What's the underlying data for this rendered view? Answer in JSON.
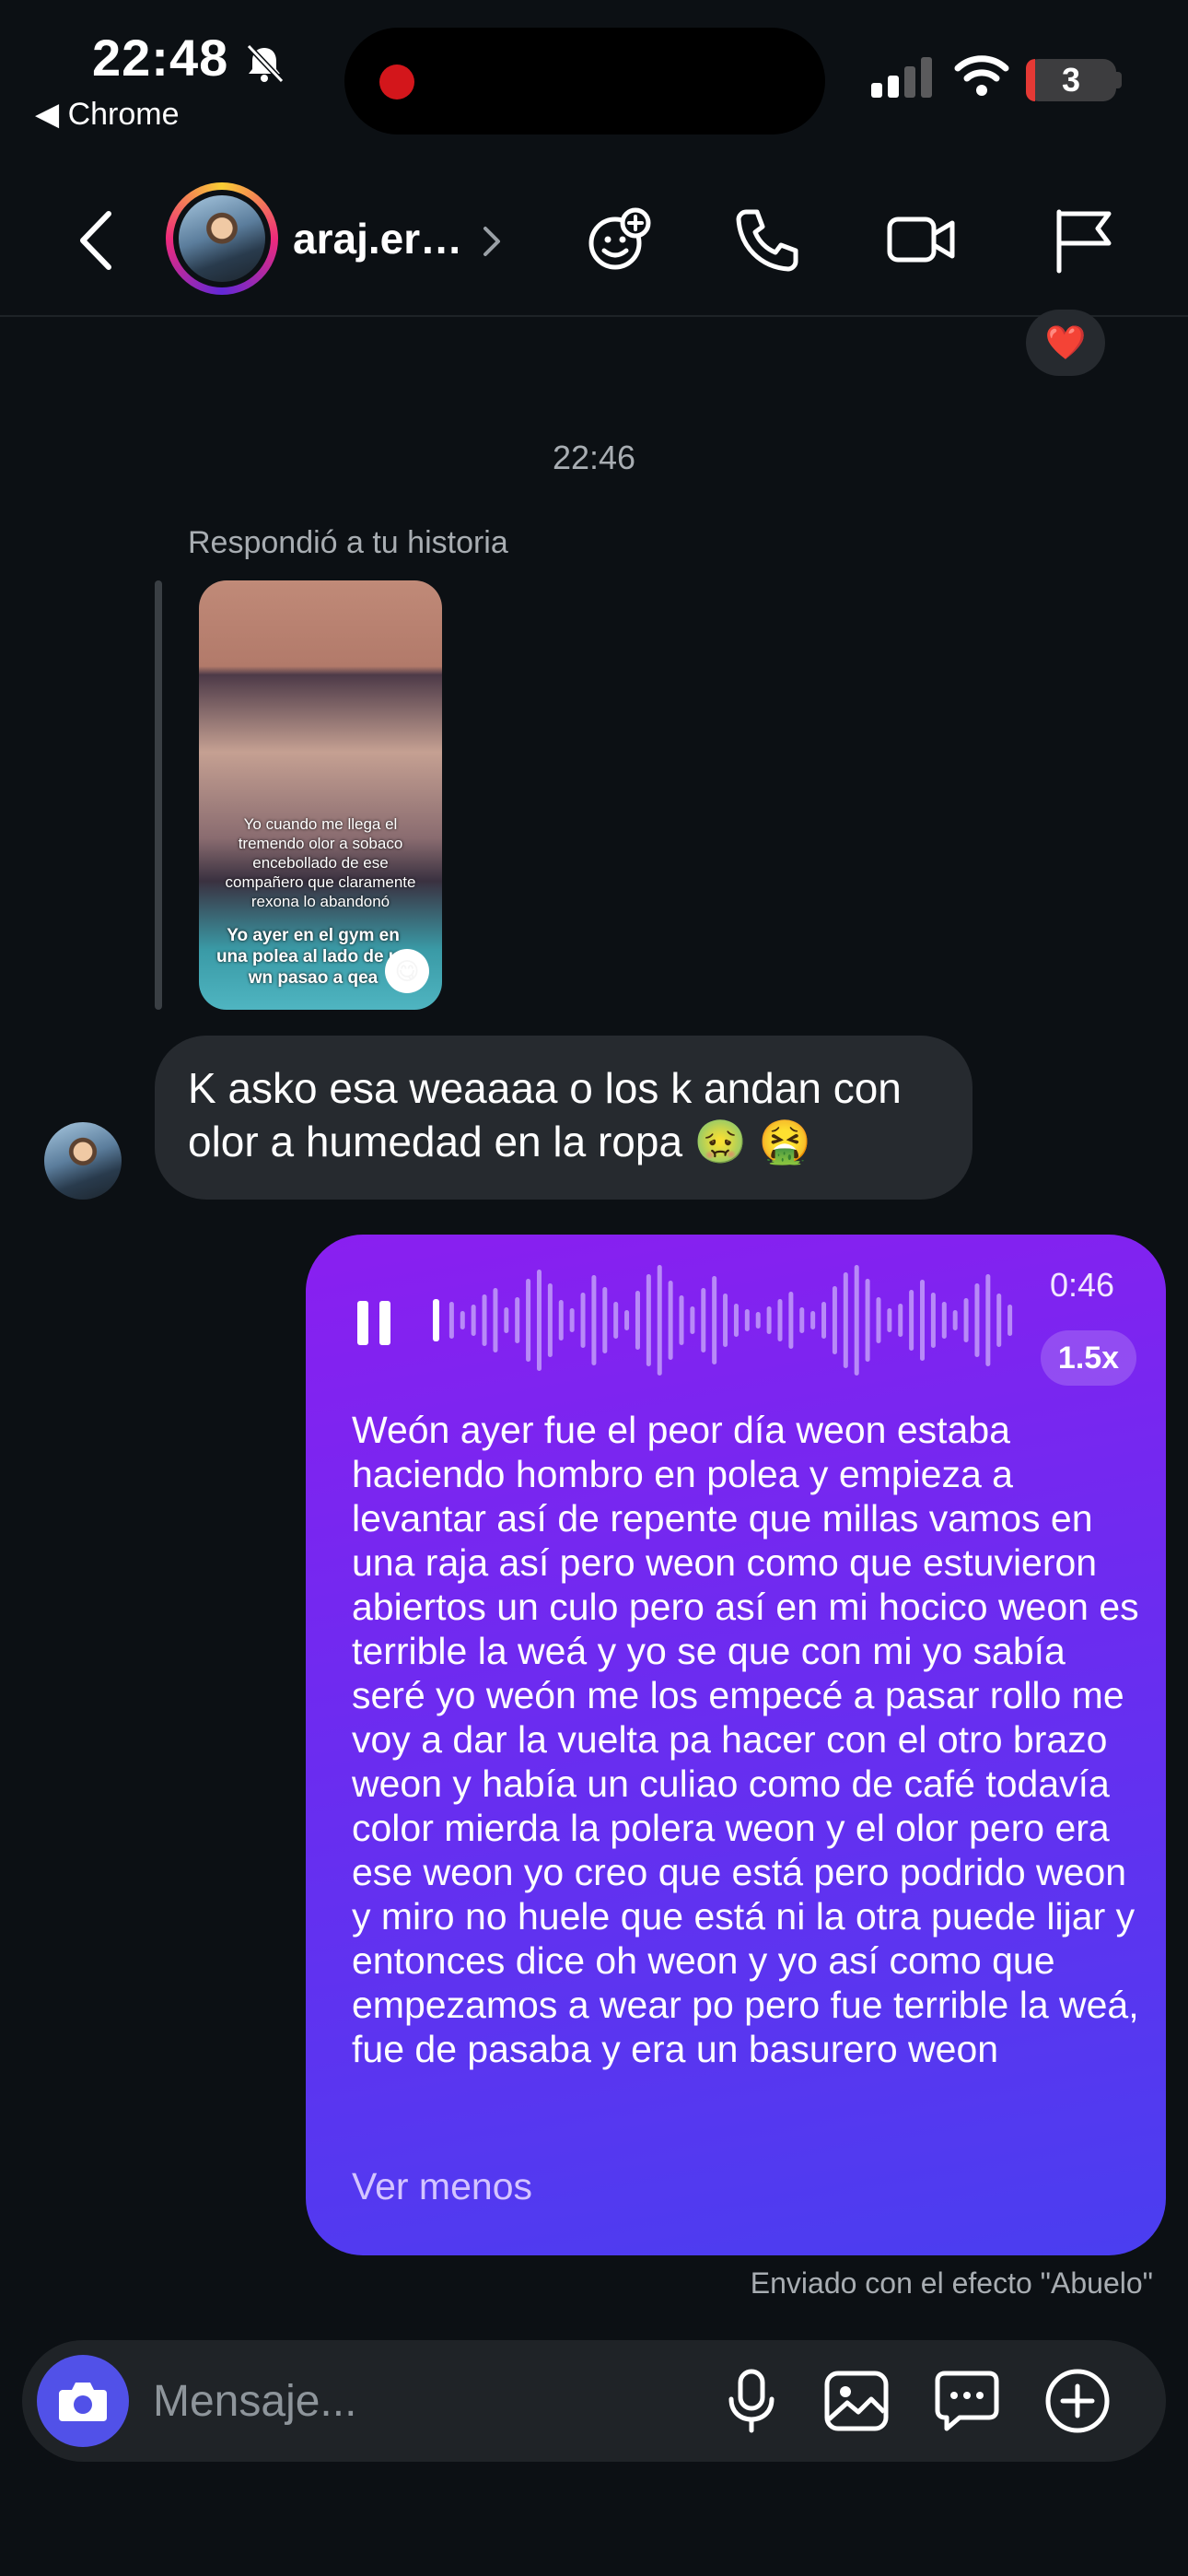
{
  "status_bar": {
    "time": "22:48",
    "back_app": "◀ Chrome",
    "battery": "3",
    "icons": [
      "bell-slash-icon",
      "signal-icon",
      "wifi-icon",
      "battery-icon"
    ]
  },
  "header": {
    "username": "araj.er…",
    "icons": [
      "back-chevron-icon",
      "chevron-right-icon",
      "sticker-effects-icon",
      "phone-icon",
      "video-icon",
      "flag-icon"
    ]
  },
  "chat": {
    "reaction_emoji": "❤️",
    "timestamp": "22:46",
    "reply_label": "Respondió a tu historia",
    "story": {
      "caption": "Yo cuando me llega el tremendo olor a sobaco encebollado de ese compañero que claramente rexona lo abandonó",
      "caption2": "Yo ayer en el gym en una polea al lado de un wn pasao a qea",
      "sticker": "😋"
    },
    "incoming_message": "K asko esa weaaaa o los k andan con olor a humedad en la ropa 🤢 🤮",
    "voice_message": {
      "duration": "0:46",
      "speed": "1.5x",
      "transcript": "Weón ayer fue el peor día weon estaba haciendo hombro en polea y empieza a levantar así de repente que millas vamos en una raja así pero weon como que estuvieron abiertos un culo pero así en mi hocico weon es terrible la weá y yo se que con mi yo sabía seré yo weón me los empecé a pasar rollo me voy a dar la vuelta pa hacer con el otro brazo weon y había un culiao como de café todavía color mierda la polera weon y el olor pero era ese weon yo creo que está pero podrido weon y miro no huele que está ni la otra puede lijar y entonces dice oh weon y yo así como que empezamos a wear po pero fue terrible la weá, fue de pasaba y era un basurero weon",
      "toggle_label": "Ver menos"
    },
    "effect_note": "Enviado con el efecto \"Abuelo\""
  },
  "composer": {
    "placeholder": "Mensaje...",
    "icons": [
      "camera-icon",
      "microphone-icon",
      "gallery-icon",
      "sticker-chat-icon",
      "plus-circle-icon"
    ]
  },
  "colors": {
    "background": "#0c1014",
    "incoming_bubble": "#262a2f",
    "voice_bubble_start": "#8a1ff0",
    "voice_bubble_end": "#4a3ef0",
    "camera_button": "#5151e8"
  }
}
